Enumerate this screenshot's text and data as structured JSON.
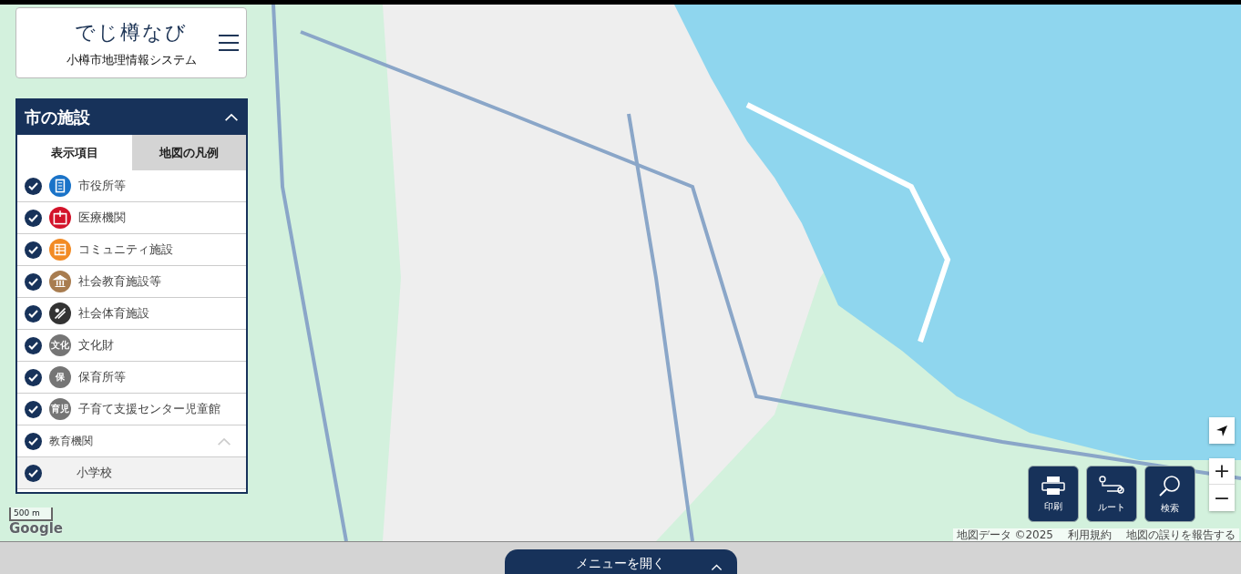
{
  "logo": {
    "title": "でじ樽なび",
    "subtitle": "小樽市地理情報システム"
  },
  "panel": {
    "title": "市の施設",
    "expanded": true,
    "tabs": [
      {
        "label": "表示項目",
        "selected": true
      },
      {
        "label": "地図の凡例",
        "selected": false
      }
    ],
    "items": [
      {
        "kind": "category",
        "label": "市役所等",
        "checked": true,
        "color": "#1a73c8"
      },
      {
        "kind": "category",
        "label": "医療機関",
        "checked": true,
        "color": "#d3132a"
      },
      {
        "kind": "category",
        "label": "コミュニティ施設",
        "checked": true,
        "color": "#f28b25"
      },
      {
        "kind": "category",
        "label": "社会教育施設等",
        "checked": true,
        "color": "#a87c4f"
      },
      {
        "kind": "category",
        "label": "社会体育施設",
        "checked": true,
        "color": "#333333"
      },
      {
        "kind": "category",
        "label": "文化財",
        "checked": true,
        "icon_text": "文化",
        "color": "#757575"
      },
      {
        "kind": "category",
        "label": "保育所等",
        "checked": true,
        "icon_text": "保",
        "color": "#757575"
      },
      {
        "kind": "category",
        "label": "子育て支援センター児童館",
        "checked": true,
        "icon_text": "育児",
        "color": "#757575"
      },
      {
        "kind": "group",
        "label": "教育機関",
        "checked": true,
        "expanded": true
      },
      {
        "kind": "sub",
        "label": "小学校",
        "checked": true
      }
    ]
  },
  "map": {
    "scale": "500 m",
    "logo": "Google",
    "attribution": [
      "地図データ ©2025",
      "利用規約",
      "地図の誤りを報告する"
    ]
  },
  "actions": [
    {
      "label": "印刷"
    },
    {
      "label": "ルート"
    },
    {
      "label": "検索"
    }
  ],
  "zoom": {
    "in": "+",
    "out": "−"
  },
  "menu_button": {
    "label": "メニューを開く",
    "expanded": false
  }
}
